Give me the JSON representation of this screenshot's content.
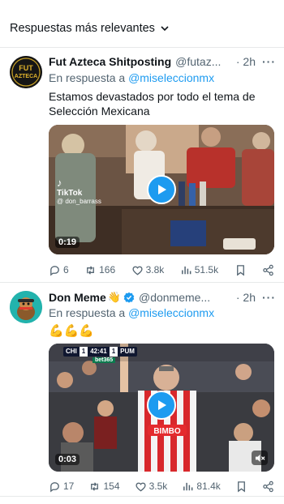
{
  "header": {
    "sort_label": "Respuestas más relevantes"
  },
  "tweets": [
    {
      "name": "Fut Azteca Shitposting",
      "handle": "@futaz...",
      "time": "· 2h",
      "more": "···",
      "reply_prefix": "En respuesta a",
      "reply_mention": "@miseleccionmx",
      "text": "Estamos devastados por todo el tema de Selección Mexicana",
      "avatar_text_1": "FUT",
      "avatar_text_2": "AZTECA",
      "media": {
        "duration": "0:19",
        "tiktok": "TikTok",
        "tiktok_user": "@ don_barrass"
      },
      "stats": {
        "replies": "6",
        "retweets": "166",
        "likes": "3.8k",
        "views": "51.5k"
      }
    },
    {
      "name": "Don Meme",
      "handle": "@donmeme...",
      "time": "· 2h",
      "more": "···",
      "reply_prefix": "En respuesta a",
      "reply_mention": "@miseleccionmx",
      "text": "💪💪💪",
      "name_emoji": "👋",
      "media": {
        "duration": "0:03",
        "score_team_1": "CHI",
        "score_1": "1",
        "score_clock": "42:41",
        "score_2": "1",
        "score_team_2": "PUM",
        "bet": "bet365",
        "shirt_brand": "BIMBO"
      },
      "stats": {
        "replies": "17",
        "retweets": "154",
        "likes": "3.5k",
        "views": "81.4k"
      }
    }
  ],
  "colors": {
    "accent": "#1d9bf0",
    "muted": "#536471",
    "divider": "#e7e9ea"
  }
}
